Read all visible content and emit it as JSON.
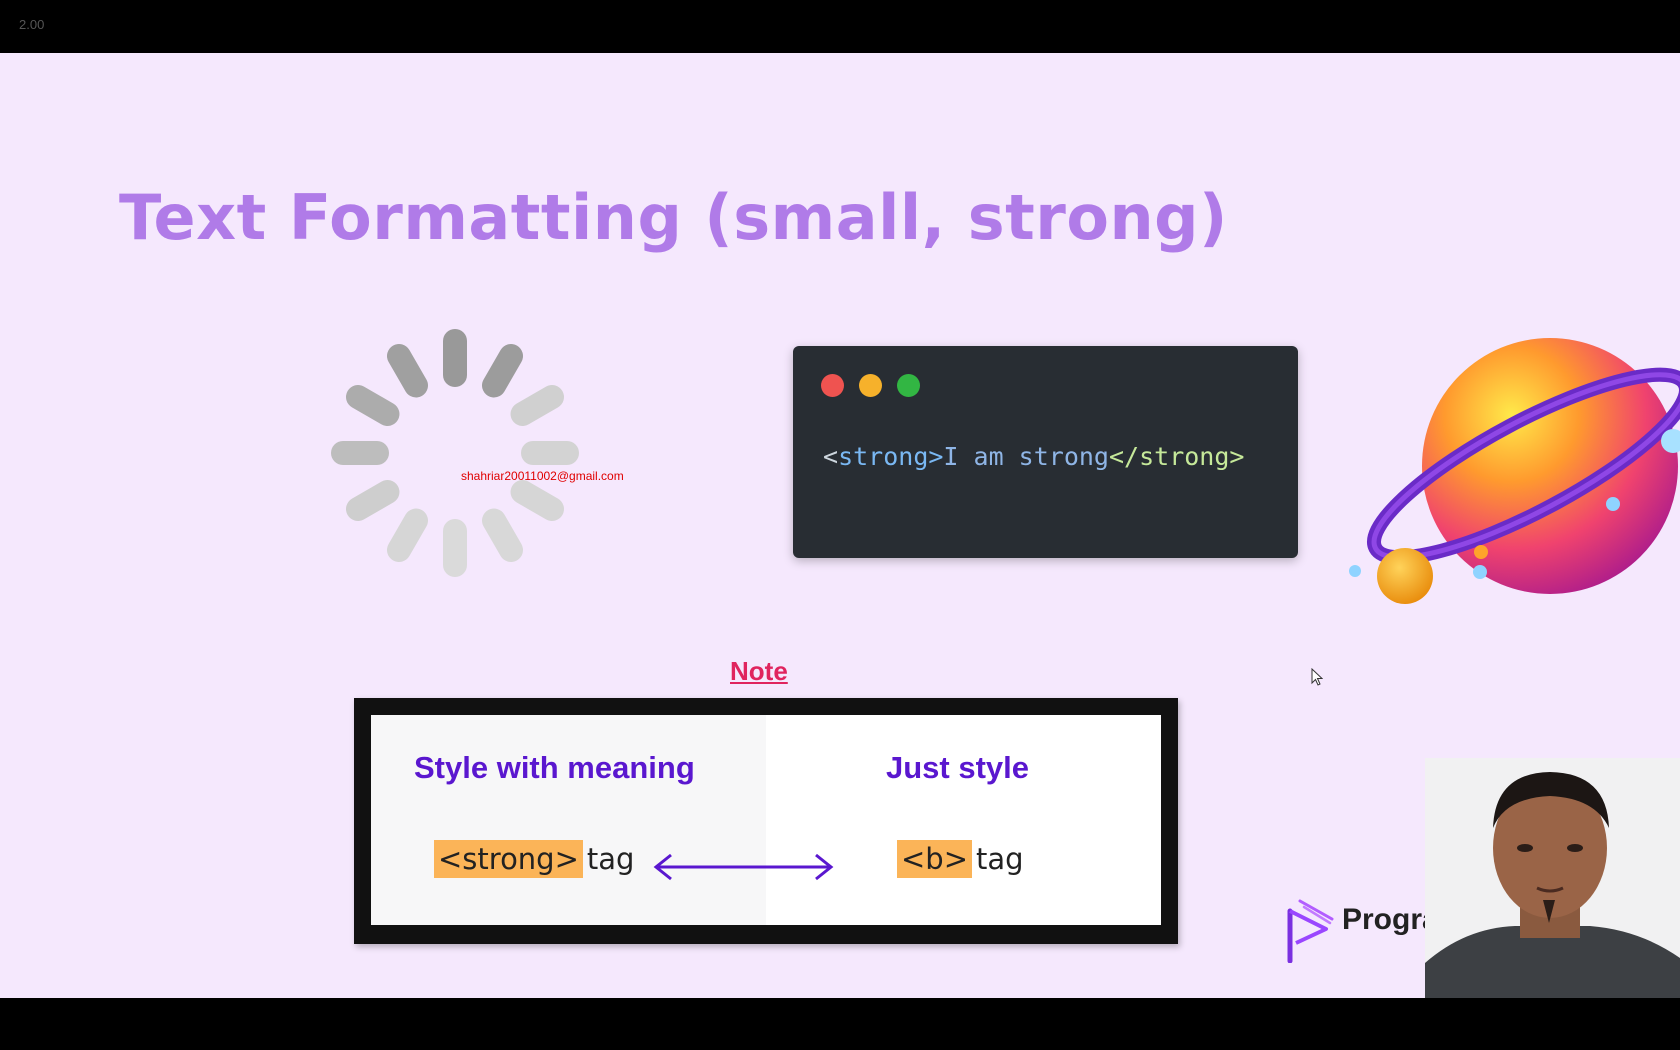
{
  "player": {
    "speed_label": "2.00"
  },
  "slide": {
    "title": "Text Formatting (small, strong)",
    "watermark": "shahriar20011002@gmail.com",
    "code_window": {
      "dots": [
        "red",
        "yellow",
        "green"
      ],
      "open_bracket": "<",
      "open_tag": "strong>",
      "text": "I am strong",
      "close_tag": "</strong>"
    },
    "note_label": "Note",
    "comparison": {
      "left_heading": "Style with meaning",
      "right_heading": "Just style",
      "left_tag": "<strong>",
      "left_suffix": "tag",
      "right_tag": "<b>",
      "right_suffix": "tag"
    },
    "brand_text": "Programmin"
  },
  "colors": {
    "title": "#b07be8",
    "note": "#e0245e",
    "heading": "#5a17cf",
    "highlight": "#fbb458",
    "code_bg": "#282d33"
  },
  "icons": [
    "loading-spinner-icon",
    "planet-illustration",
    "mouse-cursor-icon",
    "programming-hero-logo-icon",
    "double-arrow-icon"
  ]
}
